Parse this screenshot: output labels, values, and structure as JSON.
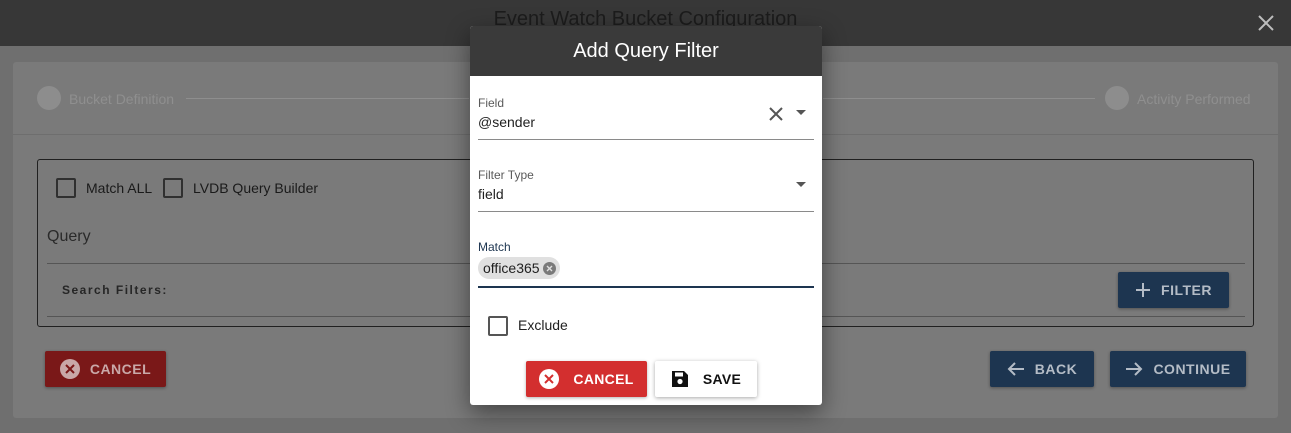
{
  "window": {
    "title": "Event Watch Bucket Configuration",
    "close_icon": "close-icon"
  },
  "stepper": {
    "steps": [
      {
        "label": "Bucket Definition"
      },
      {
        "label": "Activity Performed"
      }
    ]
  },
  "query_builder": {
    "match_all_label": "Match ALL",
    "match_all_checked": false,
    "lvdb_label": "LVDB Query Builder",
    "lvdb_checked": false,
    "query_label": "Query",
    "search_filters_label": "Search Filters:",
    "filter_button": "FILTER"
  },
  "footer": {
    "cancel_label": "CANCEL",
    "back_label": "BACK",
    "continue_label": "CONTINUE"
  },
  "dialog": {
    "title": "Add Query Filter",
    "field": {
      "label": "Field",
      "value": "@sender"
    },
    "filter_type": {
      "label": "Filter Type",
      "value": "field"
    },
    "match": {
      "label": "Match",
      "chips": [
        "office365"
      ]
    },
    "exclude": {
      "label": "Exclude",
      "checked": false
    },
    "cancel_label": "CANCEL",
    "save_label": "SAVE"
  },
  "colors": {
    "primary": "#1d3550",
    "danger": "#d32f2f",
    "header": "#3a3a3a"
  }
}
